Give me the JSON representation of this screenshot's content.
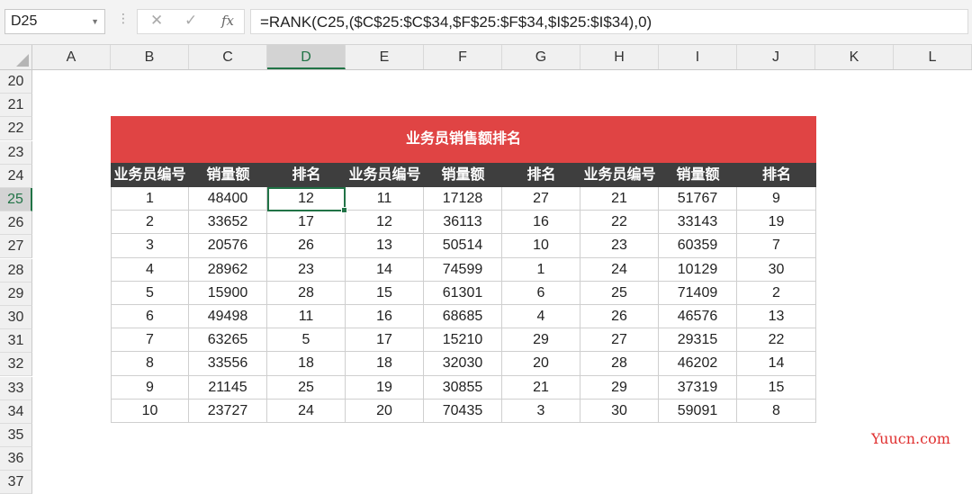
{
  "formula_bar": {
    "name_box": "D25",
    "cancel_glyph": "✕",
    "enter_glyph": "✓",
    "fx_label": "fx",
    "formula": "=RANK(C25,($C$25:$C$34,$F$25:$F$34,$I$25:$I$34),0)"
  },
  "columns": [
    "A",
    "B",
    "C",
    "D",
    "E",
    "F",
    "G",
    "H",
    "I",
    "J",
    "K",
    "L"
  ],
  "selected_column": "D",
  "rows": [
    "20",
    "21",
    "22",
    "23",
    "24",
    "25",
    "26",
    "27",
    "28",
    "29",
    "30",
    "31",
    "32",
    "33",
    "34",
    "35",
    "36",
    "37"
  ],
  "selected_row": "25",
  "table": {
    "title": "业务员销售额排名",
    "headers": [
      "业务员编号",
      "销量额",
      "排名",
      "业务员编号",
      "销量额",
      "排名",
      "业务员编号",
      "销量额",
      "排名"
    ],
    "rows": [
      [
        "1",
        "48400",
        "12",
        "11",
        "17128",
        "27",
        "21",
        "51767",
        "9"
      ],
      [
        "2",
        "33652",
        "17",
        "12",
        "36113",
        "16",
        "22",
        "33143",
        "19"
      ],
      [
        "3",
        "20576",
        "26",
        "13",
        "50514",
        "10",
        "23",
        "60359",
        "7"
      ],
      [
        "4",
        "28962",
        "23",
        "14",
        "74599",
        "1",
        "24",
        "10129",
        "30"
      ],
      [
        "5",
        "15900",
        "28",
        "15",
        "61301",
        "6",
        "25",
        "71409",
        "2"
      ],
      [
        "6",
        "49498",
        "11",
        "16",
        "68685",
        "4",
        "26",
        "46576",
        "13"
      ],
      [
        "7",
        "63265",
        "5",
        "17",
        "15210",
        "29",
        "27",
        "29315",
        "22"
      ],
      [
        "8",
        "33556",
        "18",
        "18",
        "32030",
        "20",
        "28",
        "46202",
        "14"
      ],
      [
        "9",
        "21145",
        "25",
        "19",
        "30855",
        "21",
        "29",
        "37319",
        "15"
      ],
      [
        "10",
        "23727",
        "24",
        "20",
        "70435",
        "3",
        "30",
        "59091",
        "8"
      ]
    ]
  },
  "watermark": "Yuucn.com",
  "colors": {
    "banner": "#e04444",
    "header_bg": "#3e3e3e",
    "selection": "#217346"
  }
}
